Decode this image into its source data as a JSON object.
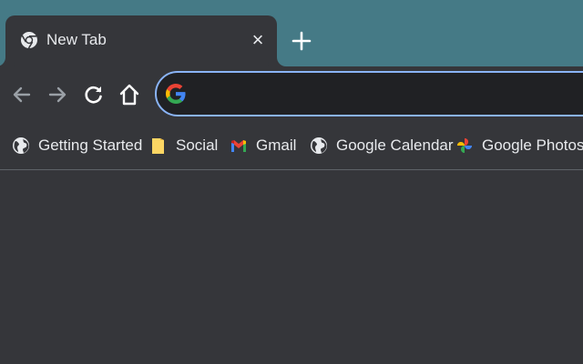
{
  "colors": {
    "titlebar": "#457a86",
    "toolbar": "#35363a",
    "text": "#e8eaed",
    "omnibox_border": "#8ab4f8",
    "omnibox_bg": "#202124"
  },
  "tab": {
    "title": "New Tab",
    "favicon": "chrome-icon",
    "close_glyph": "×"
  },
  "new_tab_button": {
    "icon": "plus-icon"
  },
  "toolbar": {
    "back": {
      "icon": "arrow-left-icon",
      "enabled": false
    },
    "forward": {
      "icon": "arrow-right-icon",
      "enabled": false
    },
    "reload": {
      "icon": "reload-icon"
    },
    "home": {
      "icon": "home-icon"
    },
    "omnibox": {
      "value": "",
      "icon": "google-g-icon"
    }
  },
  "bookmarks": [
    {
      "label": "Getting Started",
      "icon": "globe-icon"
    },
    {
      "label": "Social",
      "icon": "folder-icon"
    },
    {
      "label": "Gmail",
      "icon": "gmail-icon"
    },
    {
      "label": "Google Calendar",
      "icon": "globe-icon"
    },
    {
      "label": "Google Photos",
      "icon": "google-photos-icon"
    }
  ]
}
